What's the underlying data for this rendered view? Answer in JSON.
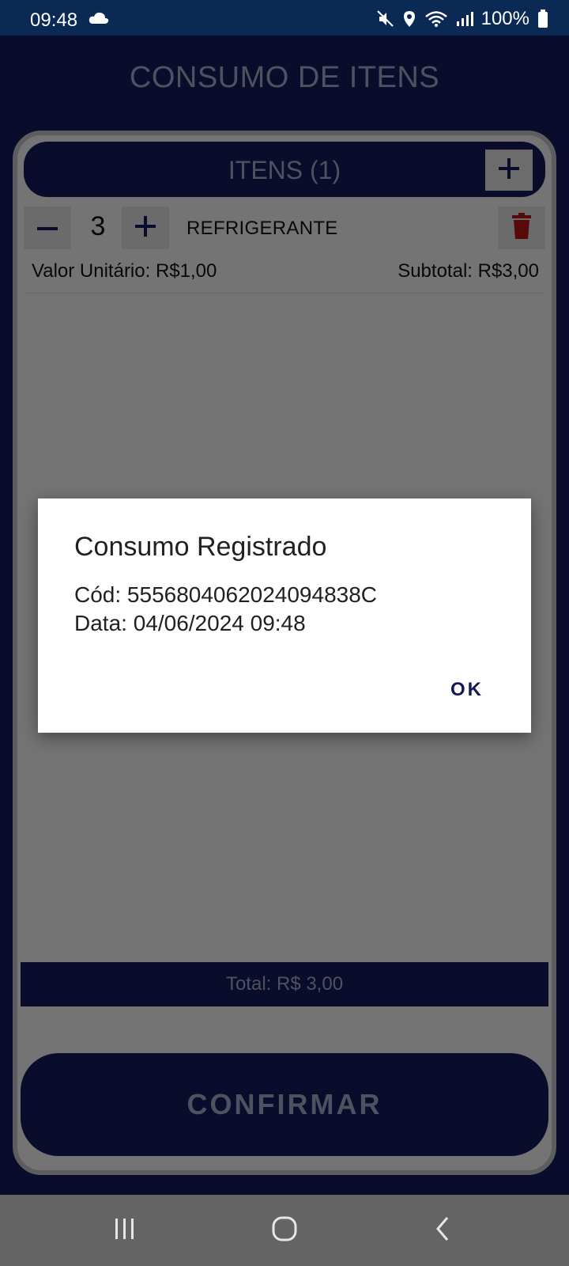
{
  "status_bar": {
    "time": "09:48",
    "battery": "100%",
    "icons": [
      "cloud-icon",
      "mute-icon",
      "location-icon",
      "wifi-icon",
      "signal-icon",
      "battery-icon"
    ]
  },
  "page": {
    "title": "CONSUMO DE ITENS"
  },
  "items_header": {
    "title": "ITENS (1)",
    "add_icon": "plus-icon"
  },
  "items": [
    {
      "quantity": "3",
      "name": "REFRIGERANTE",
      "unit_price": "Valor Unitário: R$1,00",
      "subtotal": "Subtotal: R$3,00"
    }
  ],
  "total": "Total: R$ 3,00",
  "confirm_label": "CONFIRMAR",
  "dialog": {
    "title": "Consumo Registrado",
    "line1": "Cód: 5556804062024094838C",
    "line2": "Data: 04/06/2024 09:48",
    "ok_label": "OK"
  },
  "nav": {
    "icons": [
      "recents-icon",
      "home-icon",
      "back-icon"
    ]
  },
  "colors": {
    "primary": "#121a56",
    "status_bar": "#0a2a55",
    "muted_text": "#9ea2c2",
    "delete_red": "#b01212"
  }
}
